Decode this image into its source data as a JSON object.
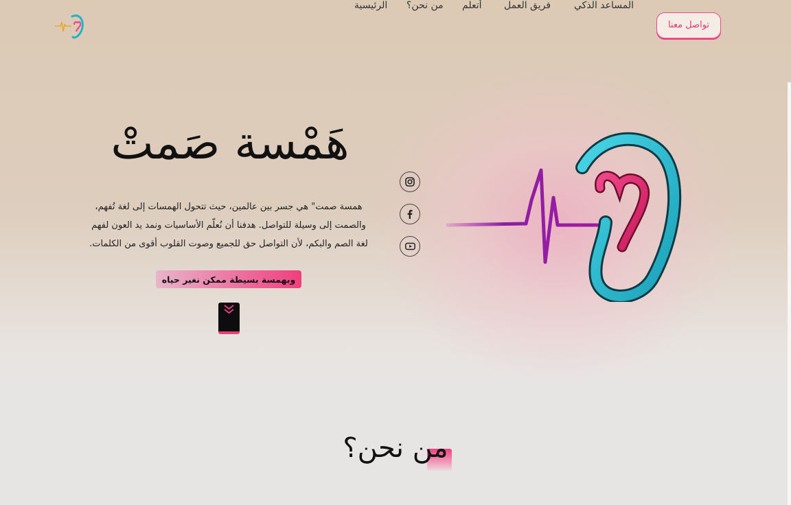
{
  "nav": {
    "links": [
      "الرئيسية",
      "من نحن؟",
      "أتعلم",
      "فريق العمل",
      "المساعد الذكي"
    ],
    "contact_label": "تواصل معنا"
  },
  "hero": {
    "title": "هَمْسة صَمتْ",
    "paragraph": "همسة صمت\" هي جسر بين عالمين، حيث تتحول الهمسات إلى لغة تُفهم، والصمت إلى وسيلة للتواصل. هدفنا أن نُعلّم الأساسيات ونمد يد العون لفهم لغة الصم والبكم، لأن التواصل حق للجميع وصوت القلوب أقوى من الكلمات.",
    "tagline": "وبهمسة بسيطة ممكن نغير حياه"
  },
  "social": [
    "instagram-icon",
    "facebook-icon",
    "youtube-icon"
  ],
  "about": {
    "title": "من نحن؟"
  },
  "colors": {
    "accent": "#e94b86",
    "teal": "#1fb3c8",
    "purple": "#8a1fa0",
    "dark": "#0d0d10"
  }
}
